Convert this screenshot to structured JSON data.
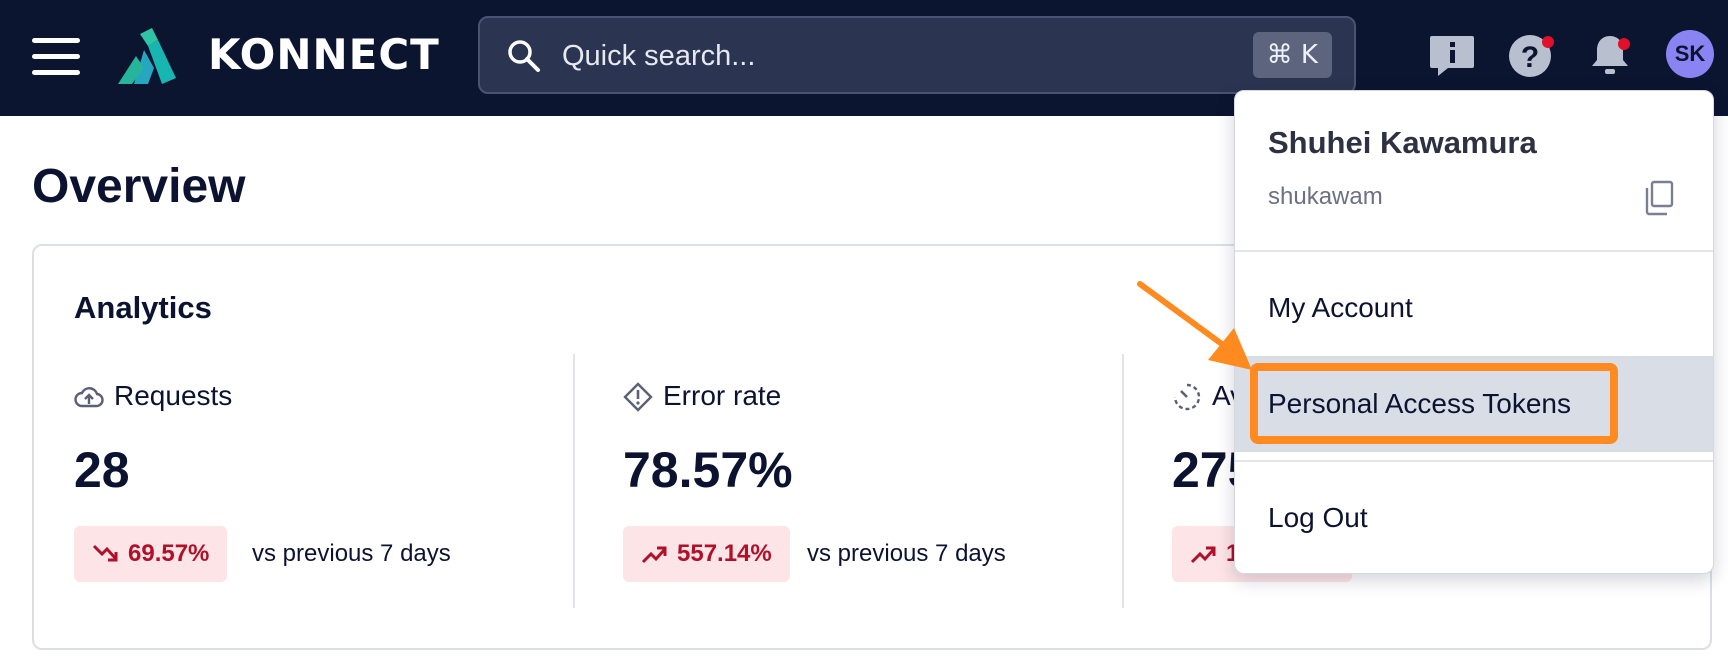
{
  "header": {
    "brand": "KONNECT",
    "search_placeholder": "Quick search...",
    "search_shortcut": "⌘ K",
    "avatar_initials": "SK",
    "icons": [
      "menu-icon",
      "feedback-icon",
      "help-icon",
      "notification-bell-icon"
    ],
    "colors": {
      "bar": "#0b1530",
      "avatar": "#8a84f2",
      "notification_dot": "#e0102a"
    }
  },
  "page": {
    "title": "Overview"
  },
  "analytics": {
    "title": "Analytics",
    "metrics": [
      {
        "label": "Requests",
        "icon": "cloud-upload-icon",
        "value": "28",
        "change": "69.57%",
        "trend": "down",
        "comparison": "vs previous 7 days"
      },
      {
        "label": "Error rate",
        "icon": "warning-diamond-icon",
        "value": "78.57%",
        "change": "557.14%",
        "trend": "up",
        "comparison": "vs previous 7 days"
      },
      {
        "label": "Av",
        "icon": "latency-gauge-icon",
        "value": "275",
        "change": "1",
        "trend": "up"
      }
    ],
    "colors": {
      "badge_bg": "#fde4e6",
      "badge_text": "#b0102a"
    }
  },
  "user_menu": {
    "name": "Shuhei Kawamura",
    "username": "shukawam",
    "items": [
      "My Account",
      "Personal Access Tokens",
      "Log Out"
    ],
    "active_item": "Personal Access Tokens",
    "colors": {
      "highlight": "#ff8a1f",
      "active_bg": "#d9dde6"
    }
  }
}
